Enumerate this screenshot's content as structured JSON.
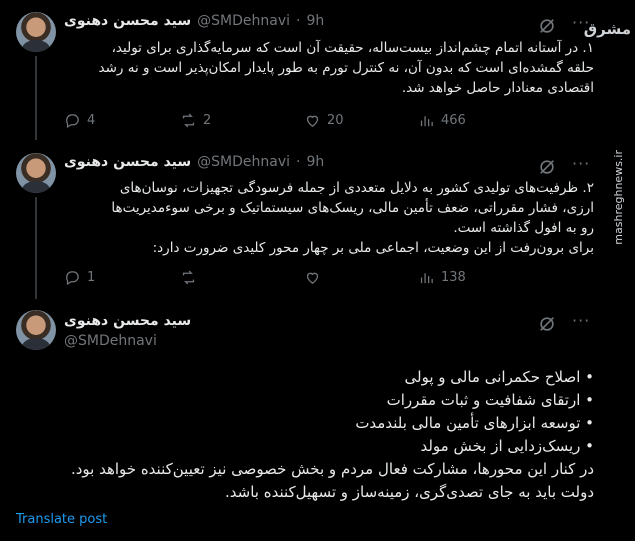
{
  "watermark": {
    "logo": "مشرق",
    "site": "mashreghnews.ir"
  },
  "tweets": [
    {
      "name": "سید محسن دهنوی",
      "handle": "@SMDehnavi",
      "dot": "·",
      "time": "9h",
      "lines": [
        "۱. در آستانه اتمام چشم‌انداز بیست‌ساله، حقیقت آن است که سرمایه‌گذاری برای تولید،",
        "حلقه گمشده‌ای است که بدون آن، نه کنترل تورم به طور پایدار امکان‌پذیر است و نه رشد",
        "اقتصادی معنادار حاصل خواهد شد."
      ],
      "replies": "4",
      "reposts": "2",
      "likes": "20",
      "views": "466"
    },
    {
      "name": "سید محسن دهنوی",
      "handle": "@SMDehnavi",
      "dot": "·",
      "time": "9h",
      "lines": [
        "۲. ظرفیت‌های تولیدی کشور به دلایل متعددی از جمله فرسودگی تجهیزات، نوسان‌های",
        "ارزی، فشار مقرراتی، ضعف تأمین مالی، ریسک‌های سیستماتیک و برخی سوءمدیریت‌ها",
        "رو به افول گذاشته است.",
        "برای برون‌رفت از این وضعیت، اجماعی ملی بر چهار محور کلیدی ضرورت دارد:"
      ],
      "replies": "1",
      "reposts": "",
      "likes": "",
      "views": "138"
    }
  ],
  "main": {
    "name": "سید محسن دهنوی",
    "handle": "@SMDehnavi",
    "lines": [
      "• اصلاح حکمرانی مالی و پولی",
      "• ارتقای شفافیت و ثبات مقررات",
      "• توسعه ابزارهای تأمین مالی بلندمدت",
      "• ریسک‌زدایی از بخش مولد",
      "در کنار این محورها، مشارکت فعال مردم و بخش خصوصی نیز تعیین‌کننده خواهد بود.",
      "دولت باید به جای تصدی‌گری، زمینه‌ساز و تسهیل‌کننده باشد."
    ],
    "translate": "Translate post"
  },
  "icons": {
    "more": "more-horizontal-icon",
    "grok": "grok-icon",
    "reply": "reply-icon",
    "repost": "repost-icon",
    "like": "heart-icon",
    "views": "views-icon"
  },
  "colors": {
    "background": "#000000",
    "text": "#e7e9ea",
    "muted": "#71767b",
    "link": "#1d9bf0"
  }
}
